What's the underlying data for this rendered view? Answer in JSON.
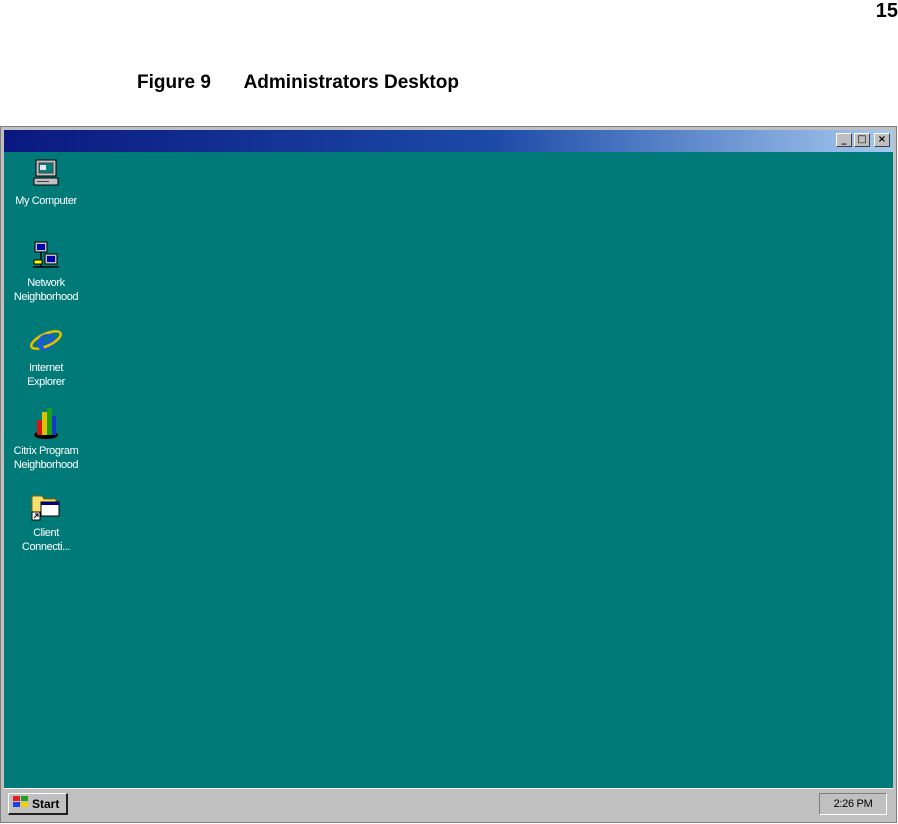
{
  "page": {
    "number": "15"
  },
  "caption": {
    "label": "Figure 9",
    "title": "Administrators Desktop"
  },
  "window": {
    "controls": {
      "minimize": "_",
      "maximize": "□",
      "close": "×"
    }
  },
  "desktop": {
    "background_color": "#007a78",
    "icons": [
      {
        "label": "My Computer",
        "icon": "my-computer-icon"
      },
      {
        "label": "Network\nNeighborhood",
        "icon": "network-neighborhood-icon"
      },
      {
        "label": "Internet\nExplorer",
        "icon": "internet-explorer-icon"
      },
      {
        "label": "Citrix Program\nNeighborhood",
        "icon": "citrix-program-neighborhood-icon"
      },
      {
        "label": "Client\nConnecti...",
        "icon": "client-connection-shortcut-icon"
      }
    ]
  },
  "taskbar": {
    "start_label": "Start",
    "clock": "2:26 PM"
  }
}
